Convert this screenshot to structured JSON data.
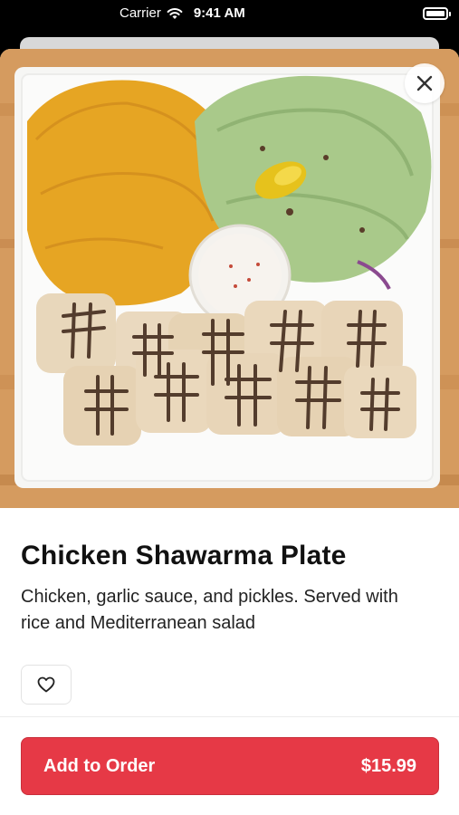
{
  "status_bar": {
    "carrier": "Carrier",
    "time": "9:41 AM",
    "wifi_icon": "wifi-icon",
    "battery_icon": "battery-icon"
  },
  "item": {
    "image_alt_icon": "food-photo",
    "title": "Chicken Shawarma Plate",
    "description": "Chicken, garlic sauce, and pickles. Served with rice and Mediterranean salad"
  },
  "actions": {
    "close_icon": "close-icon",
    "favorite_icon": "heart-icon",
    "add_label": "Add to Order",
    "price": "$15.99"
  },
  "colors": {
    "accent": "#e63946",
    "text": "#111111"
  }
}
